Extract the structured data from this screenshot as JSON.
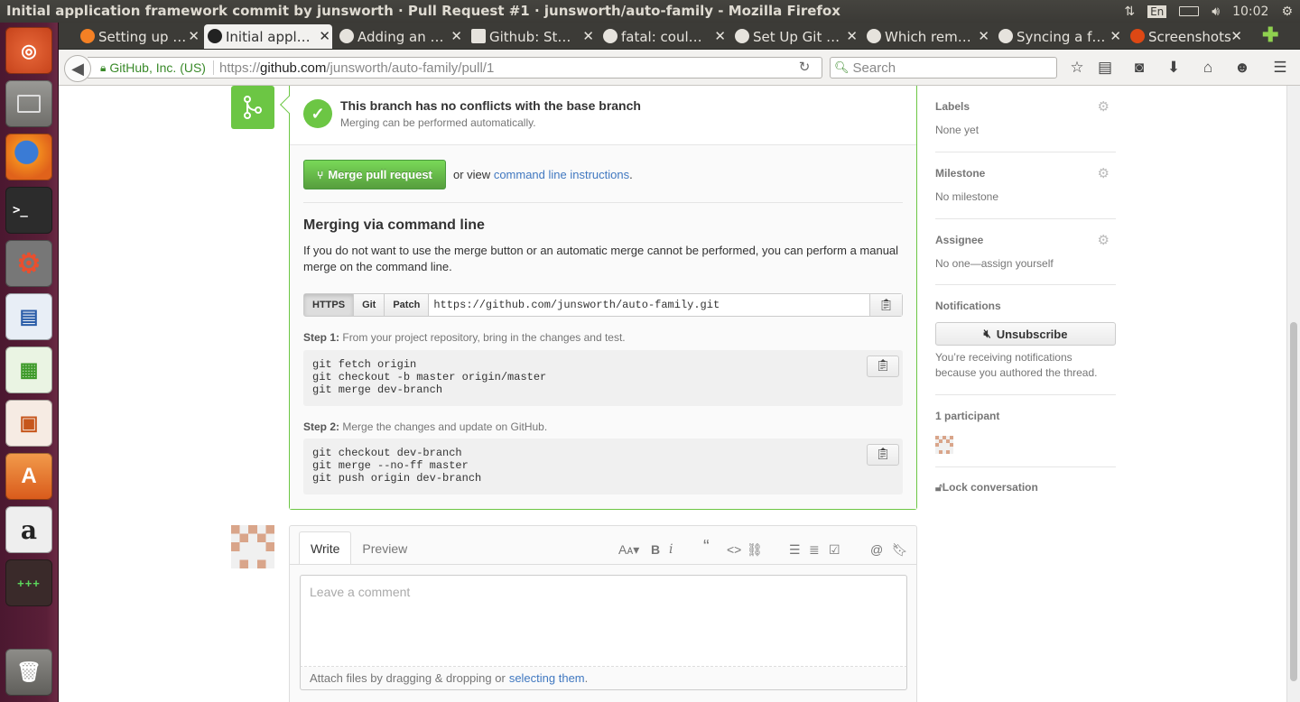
{
  "window": {
    "title": "Initial application framework commit by junsworth · Pull Request #1 · junsworth/auto-family - Mozilla Firefox",
    "keyboard": "En",
    "clock": "10:02"
  },
  "tabs": [
    {
      "label": "Setting up …"
    },
    {
      "label": "Initial appl…"
    },
    {
      "label": "Adding an …"
    },
    {
      "label": "Github: St…"
    },
    {
      "label": "fatal: coul…"
    },
    {
      "label": "Set Up Git …"
    },
    {
      "label": "Which rem…"
    },
    {
      "label": "Syncing a f…"
    },
    {
      "label": "Screenshots"
    }
  ],
  "tab_close": "✕",
  "nav": {
    "identity": "GitHub, Inc. (US)",
    "url_scheme": "https://",
    "url_host": "github.com",
    "url_path": "/junsworth/auto-family/pull/1",
    "search_placeholder": "Search"
  },
  "merge": {
    "title": "This branch has no conflicts with the base branch",
    "subtitle": "Merging can be performed automatically.",
    "button": "Merge pull request",
    "or_view": "or view",
    "cli_link": "command line instructions",
    "period": ".",
    "heading": "Merging via command line",
    "description": "If you do not want to use the merge button or an automatic merge cannot be performed, you can perform a manual merge on the command line.",
    "protocols": [
      "HTTPS",
      "Git",
      "Patch"
    ],
    "clone_url": "https://github.com/junsworth/auto-family.git",
    "step1_label": "Step 1:",
    "step1_text": "From your project repository, bring in the changes and test.",
    "step1_code": "git fetch origin\ngit checkout -b master origin/master\ngit merge dev-branch",
    "step2_label": "Step 2:",
    "step2_text": "Merge the changes and update on GitHub.",
    "step2_code": "git checkout dev-branch\ngit merge --no-ff master\ngit push origin dev-branch"
  },
  "comment": {
    "tab_write": "Write",
    "tab_preview": "Preview",
    "placeholder": "Leave a comment",
    "attach_text": "Attach files by dragging & dropping or",
    "attach_link": "selecting them",
    "attach_end": "."
  },
  "sidebar": {
    "labels_title": "Labels",
    "labels_value": "None yet",
    "milestone_title": "Milestone",
    "milestone_value": "No milestone",
    "assignee_title": "Assignee",
    "assignee_value": "No one—assign yourself",
    "notifications_title": "Notifications",
    "unsubscribe": "Unsubscribe",
    "notify_msg": "You’re receiving notifications because you authored the thread.",
    "participants": "1 participant",
    "lock": "Lock conversation"
  },
  "colors": {
    "success": "#6cc644",
    "link": "#4078c0",
    "launcher": "#4b1830"
  }
}
